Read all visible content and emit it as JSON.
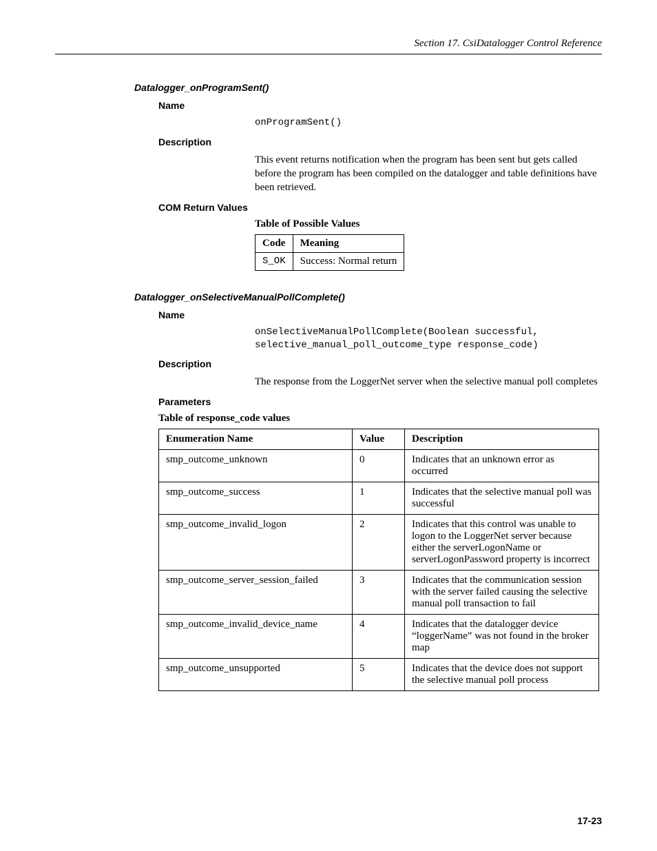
{
  "header": "Section 17.  CsiDatalogger Control Reference",
  "page_number": "17-23",
  "sec1": {
    "title": "Datalogger_onProgramSent()",
    "name_label": "Name",
    "name_value": "onProgramSent()",
    "desc_label": "Description",
    "desc_text": "This event returns notification when the program has been sent but gets called before the program has been compiled on the datalogger and table definitions have been retrieved.",
    "com_label": "COM Return Values",
    "com_caption": "Table of Possible Values",
    "com_headers": {
      "code": "Code",
      "meaning": "Meaning"
    },
    "com_rows": [
      {
        "code": "S_OK",
        "meaning": "Success: Normal return"
      }
    ]
  },
  "sec2": {
    "title": "Datalogger_onSelectiveManualPollComplete()",
    "name_label": "Name",
    "name_value": "onSelectiveManualPollComplete(Boolean successful, selective_manual_poll_outcome_type response_code)",
    "desc_label": "Description",
    "desc_text": "The response from the LoggerNet server when the selective manual poll completes",
    "param_label": "Parameters",
    "param_caption": "Table of response_code values",
    "param_headers": {
      "enum": "Enumeration Name",
      "value": "Value",
      "desc": "Description"
    },
    "param_rows": [
      {
        "enum": "smp_outcome_unknown",
        "value": "0",
        "desc": "Indicates that an unknown error as occurred"
      },
      {
        "enum": "smp_outcome_success",
        "value": "1",
        "desc": "Indicates that the selective manual poll was successful"
      },
      {
        "enum": "smp_outcome_invalid_logon",
        "value": "2",
        "desc": "Indicates that this control was unable to logon to the LoggerNet server because either the serverLogonName or serverLogonPassword property is incorrect"
      },
      {
        "enum": "smp_outcome_server_session_failed",
        "value": "3",
        "desc": "Indicates that the communication session with the server failed causing the selective manual poll transaction to fail"
      },
      {
        "enum": "smp_outcome_invalid_device_name",
        "value": "4",
        "desc": "Indicates that the datalogger device “loggerName” was not found in the broker map"
      },
      {
        "enum": "smp_outcome_unsupported",
        "value": "5",
        "desc": "Indicates that the device does not support the selective manual poll process"
      }
    ]
  }
}
